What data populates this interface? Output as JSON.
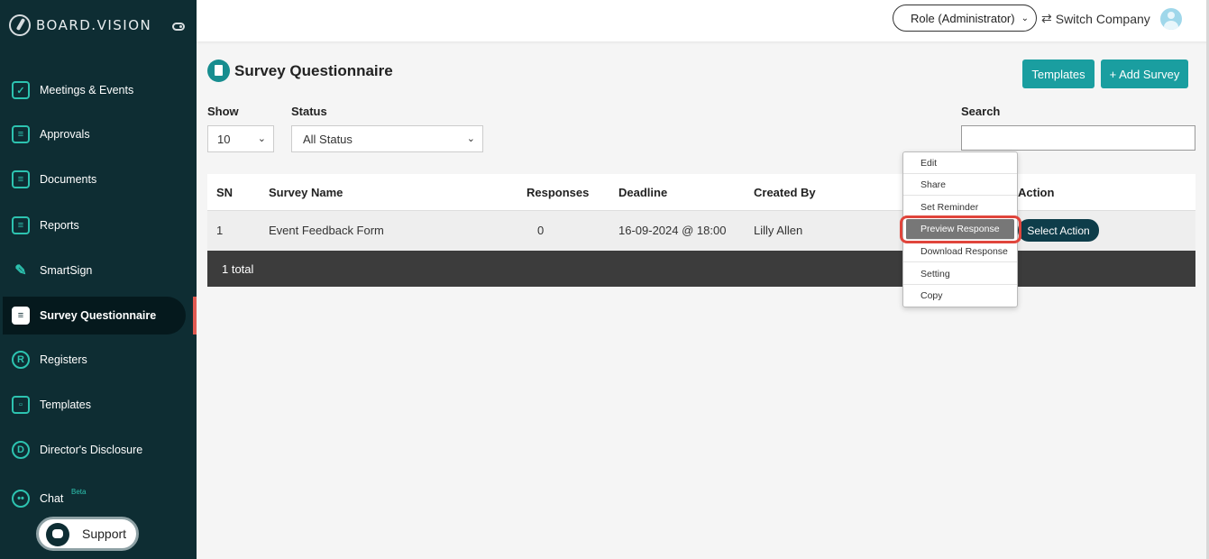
{
  "app": {
    "brand": "BOARD.VISION"
  },
  "sidebar": {
    "items": [
      {
        "label": "Meetings & Events",
        "icon": "calendar-icon"
      },
      {
        "label": "Approvals",
        "icon": "approvals-icon"
      },
      {
        "label": "Documents",
        "icon": "documents-icon"
      },
      {
        "label": "Reports",
        "icon": "reports-icon"
      },
      {
        "label": "SmartSign",
        "icon": "smartsign-icon"
      },
      {
        "label": "Survey Questionnaire",
        "icon": "survey-icon",
        "active": true
      },
      {
        "label": "Registers",
        "icon": "registers-icon"
      },
      {
        "label": "Templates",
        "icon": "templates-icon"
      },
      {
        "label": "Director's Disclosure",
        "icon": "disclosure-icon"
      },
      {
        "label": "Chat",
        "icon": "chat-icon",
        "badge": "Beta"
      }
    ],
    "support_label": "Support"
  },
  "topbar": {
    "role": "Role (Administrator)",
    "switch_company": "Switch Company"
  },
  "page": {
    "title": "Survey Questionnaire",
    "templates_button": "Templates",
    "add_survey_button": "+ Add Survey"
  },
  "filters": {
    "show_label": "Show",
    "show_value": "10",
    "status_label": "Status",
    "status_value": "All Status",
    "search_label": "Search",
    "search_value": ""
  },
  "table": {
    "headers": [
      "SN",
      "Survey Name",
      "Responses",
      "Deadline",
      "Created By",
      "Action"
    ],
    "rows": [
      {
        "sn": "1",
        "name": "Event Feedback Form",
        "responses": "0",
        "deadline": "16-09-2024 @ 18:00",
        "created_by": "Lilly Allen",
        "action": "Select Action"
      }
    ],
    "total": "1 total"
  },
  "action_menu": {
    "items": [
      "Edit",
      "Share",
      "Set Reminder",
      "Preview Response",
      "Download Response",
      "Setting",
      "Copy"
    ],
    "highlighted": "Preview Response"
  },
  "colors": {
    "sidebar_bg": "#0e2d33",
    "accent_teal": "#1a9ea0",
    "highlight_red": "#e0453c",
    "footer_dark": "#3c3c3c"
  }
}
